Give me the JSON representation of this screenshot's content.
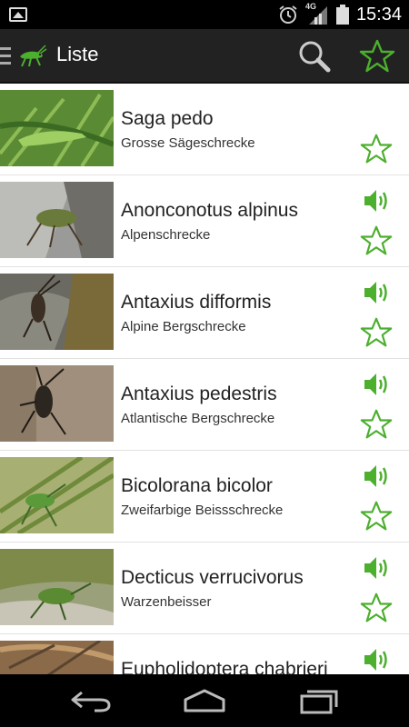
{
  "status_bar": {
    "network_label": "4G",
    "time": "15:34"
  },
  "action_bar": {
    "title": "Liste",
    "accent_color": "#4caf2e"
  },
  "species": [
    {
      "name": "Saga pedo",
      "common": "Grosse Sägeschrecke",
      "has_sound": false
    },
    {
      "name": "Anonconotus alpinus",
      "common": "Alpenschrecke",
      "has_sound": true
    },
    {
      "name": "Antaxius difformis",
      "common": "Alpine Bergschrecke",
      "has_sound": true
    },
    {
      "name": "Antaxius pedestris",
      "common": "Atlantische Bergschrecke",
      "has_sound": true
    },
    {
      "name": "Bicolorana bicolor",
      "common": "Zweifarbige Beissschrecke",
      "has_sound": true
    },
    {
      "name": "Decticus verrucivorus",
      "common": "Warzenbeisser",
      "has_sound": true
    },
    {
      "name": "Eupholidoptera chabrieri",
      "common": "",
      "has_sound": true
    }
  ],
  "icons": {
    "menu": "hamburger-icon",
    "logo": "grasshopper-logo-icon",
    "search": "search-icon",
    "favorites": "star-outline-icon",
    "sound": "speaker-icon",
    "back": "back-icon",
    "home": "home-icon",
    "recents": "recents-icon"
  }
}
